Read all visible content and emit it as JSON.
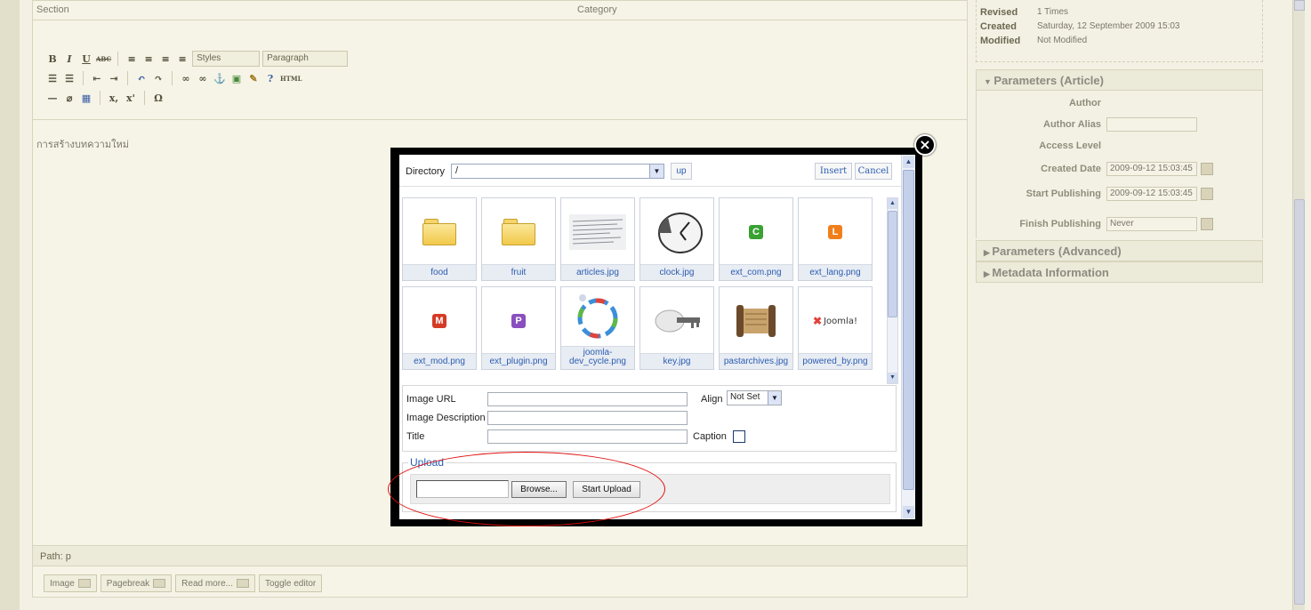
{
  "editor": {
    "section_label": "Section",
    "category_label": "Category",
    "toolbar": {
      "bold": "B",
      "italic": "I",
      "underline": "U",
      "strike": "ABC",
      "styles_select": "Styles",
      "paragraph_select": "Paragraph",
      "html_btn": "HTML",
      "subscript": "x,",
      "superscript": "x'",
      "omega": "Ω"
    },
    "content_text": "การสร้างบทความใหม่",
    "path_label": "Path: p",
    "buttons": [
      "Image",
      "Pagebreak",
      "Read more...",
      "Toggle editor"
    ]
  },
  "sidebar": {
    "meta": [
      {
        "key": "Revised",
        "value": "1 Times"
      },
      {
        "key": "Created",
        "value": "Saturday, 12 September 2009 15:03"
      },
      {
        "key": "Modified",
        "value": "Not Modified"
      }
    ],
    "params_article_title": "Parameters (Article)",
    "params": [
      {
        "label": "Author",
        "value": ""
      },
      {
        "label": "Author Alias",
        "value": ""
      },
      {
        "label": "Access Level",
        "value": ""
      },
      {
        "label": "Created Date",
        "value": "2009-09-12 15:03:45"
      },
      {
        "label": "Start Publishing",
        "value": "2009-09-12 15:03:45"
      },
      {
        "label": "Finish Publishing",
        "value": "Never"
      }
    ],
    "params_advanced_title": "Parameters (Advanced)",
    "metadata_title": "Metadata Information"
  },
  "modal": {
    "close_glyph": "×",
    "directory_label": "Directory",
    "directory_value": "/",
    "up_label": "up",
    "insert_label": "Insert",
    "cancel_label": "Cancel",
    "files": [
      {
        "name": "food",
        "kind": "folder"
      },
      {
        "name": "fruit",
        "kind": "folder"
      },
      {
        "name": "articles.jpg",
        "kind": "image"
      },
      {
        "name": "clock.jpg",
        "kind": "image"
      },
      {
        "name": "ext_com.png",
        "kind": "badge",
        "letter": "C",
        "color": "#3aa133"
      },
      {
        "name": "ext_lang.png",
        "kind": "badge",
        "letter": "L",
        "color": "#f07f1b"
      },
      {
        "name": "ext_mod.png",
        "kind": "badge",
        "letter": "M",
        "color": "#d53a26"
      },
      {
        "name": "ext_plugin.png",
        "kind": "badge",
        "letter": "P",
        "color": "#8a4fbf"
      },
      {
        "name": "joomla-dev_cycle.png",
        "kind": "image",
        "caption_lines": [
          "joomla-",
          "dev_cycle.png"
        ]
      },
      {
        "name": "key.jpg",
        "kind": "image"
      },
      {
        "name": "pastarchives.jpg",
        "kind": "image"
      },
      {
        "name": "powered_by.png",
        "kind": "image",
        "logo_text": "Joomla!"
      }
    ],
    "image_url_label": "Image URL",
    "image_url_value": "",
    "align_label": "Align",
    "align_value": "Not Set",
    "image_description_label": "Image Description",
    "image_description_value": "",
    "title_label": "Title",
    "title_value": "",
    "caption_label": "Caption",
    "upload_legend": "Upload",
    "browse_label": "Browse...",
    "start_upload_label": "Start Upload"
  },
  "colors": {
    "highlight_ring": "#e01010",
    "link_blue": "#2a5db0"
  }
}
